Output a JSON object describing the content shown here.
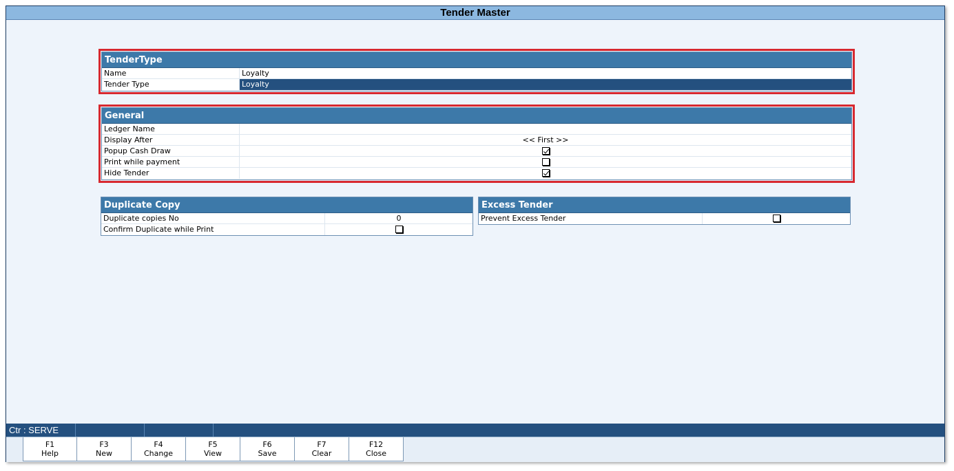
{
  "window": {
    "title": "Tender Master"
  },
  "tender_type": {
    "title": "TenderType",
    "rows": [
      {
        "label": "Name",
        "value": "Loyalty"
      },
      {
        "label": "Tender Type",
        "value": "Loyalty"
      }
    ]
  },
  "general": {
    "title": "General",
    "ledger_name": {
      "label": "Ledger Name",
      "value": ""
    },
    "display_after": {
      "label": "Display After",
      "value": "<< First >>"
    },
    "popup_cash_draw": {
      "label": "Popup Cash Draw",
      "checked": true
    },
    "print_while_payment": {
      "label": "Print while payment",
      "checked": false
    },
    "hide_tender": {
      "label": "Hide Tender",
      "checked": true
    }
  },
  "duplicate_copy": {
    "title": "Duplicate Copy",
    "copies_no": {
      "label": "Duplicate copies No",
      "value": "0"
    },
    "confirm_duplicate": {
      "label": "Confirm Duplicate while Print",
      "checked": false
    }
  },
  "excess_tender": {
    "title": "Excess Tender",
    "prevent_excess": {
      "label": "Prevent Excess Tender",
      "checked": false
    }
  },
  "status_bar": {
    "counter": "Ctr : SERVE",
    "seg2": "",
    "seg3": ""
  },
  "function_keys": [
    {
      "key": "F1",
      "label": "Help"
    },
    {
      "key": "F3",
      "label": "New"
    },
    {
      "key": "F4",
      "label": "Change"
    },
    {
      "key": "F5",
      "label": "View"
    },
    {
      "key": "F6",
      "label": "Save"
    },
    {
      "key": "F7",
      "label": "Clear"
    },
    {
      "key": "F12",
      "label": "Close"
    }
  ],
  "colors": {
    "title_bar": "#8cb8e0",
    "panel_header": "#3d79a9",
    "selection": "#24507f",
    "highlight_border": "#d7282f",
    "background": "#eef4fb"
  }
}
